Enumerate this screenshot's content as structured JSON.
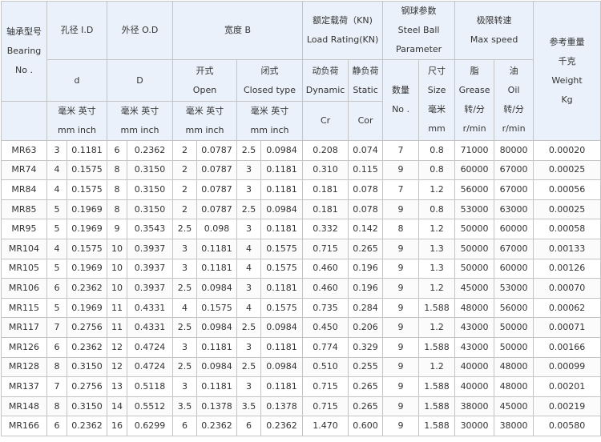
{
  "header": {
    "model": [
      "轴承型号",
      "Bearing",
      "No ."
    ],
    "id_title": "孔径 I.D",
    "od_title": "外径 O.D",
    "width_title": "宽度 B",
    "load_title": [
      "额定载荷（KN)",
      "Load Rating(KN)"
    ],
    "ball_title": [
      "钢球参数",
      "Steel Ball",
      "Parameter"
    ],
    "speed_title": [
      "极限转速",
      "Max speed"
    ],
    "weight_title": [
      "参考重量",
      "千克",
      "Weight",
      "Kg"
    ],
    "id_symbol": "d",
    "od_symbol": "D",
    "open": [
      "开式",
      "Open"
    ],
    "closed": [
      "闭式",
      "Closed type"
    ],
    "dynamic": [
      "动负荷",
      "Dynamic"
    ],
    "static": [
      "静负荷",
      "Static"
    ],
    "ball_num": [
      "数量",
      "No ."
    ],
    "ball_size": [
      "尺寸",
      "Size",
      "毫米",
      "mm"
    ],
    "grease": [
      "脂",
      "Grease",
      "转/分",
      "r/min"
    ],
    "oil": [
      "油",
      "Oil",
      "转/分",
      "r/min"
    ],
    "unit_id": [
      "毫米 英寸",
      "mm inch"
    ],
    "unit_od": [
      "毫米 英寸",
      "mm inch"
    ],
    "unit_open": [
      "毫米 英寸",
      "mm inch"
    ],
    "unit_closed": [
      "毫米 英寸",
      "mm inch"
    ],
    "cr": "Cr",
    "cor": "Cor"
  },
  "rows": [
    [
      "MR63",
      "3",
      "0.1181",
      "6",
      "0.2362",
      "2",
      "0.0787",
      "2.5",
      "0.0984",
      "0.208",
      "0.074",
      "7",
      "0.8",
      "71000",
      "80000",
      "0.00020"
    ],
    [
      "MR74",
      "4",
      "0.1575",
      "8",
      "0.3150",
      "2",
      "0.0787",
      "3",
      "0.1181",
      "0.310",
      "0.115",
      "9",
      "0.8",
      "60000",
      "67000",
      "0.00025"
    ],
    [
      "MR84",
      "4",
      "0.1575",
      "8",
      "0.3150",
      "2",
      "0.0787",
      "3",
      "0.1181",
      "0.181",
      "0.078",
      "7",
      "1.2",
      "56000",
      "67000",
      "0.00056"
    ],
    [
      "MR85",
      "5",
      "0.1969",
      "8",
      "0.3150",
      "2",
      "0.0787",
      "2.5",
      "0.0984",
      "0.181",
      "0.078",
      "9",
      "0.8",
      "53000",
      "63000",
      "0.00025"
    ],
    [
      "MR95",
      "5",
      "0.1969",
      "9",
      "0.3543",
      "2.5",
      "0.098",
      "3",
      "0.1181",
      "0.332",
      "0.142",
      "8",
      "1.2",
      "50000",
      "60000",
      "0.00058"
    ],
    [
      "MR104",
      "4",
      "0.1575",
      "10",
      "0.3937",
      "3",
      "0.1181",
      "4",
      "0.1575",
      "0.715",
      "0.265",
      "9",
      "1.3",
      "50000",
      "67000",
      "0.00133"
    ],
    [
      "MR105",
      "5",
      "0.1969",
      "10",
      "0.3937",
      "3",
      "0.1181",
      "4",
      "0.1575",
      "0.460",
      "0.196",
      "9",
      "1.3",
      "50000",
      "60000",
      "0.00126"
    ],
    [
      "MR106",
      "6",
      "0.2362",
      "10",
      "0.3937",
      "2.5",
      "0.0984",
      "3",
      "0.1181",
      "0.460",
      "0.196",
      "9",
      "1.2",
      "45000",
      "53000",
      "0.00070"
    ],
    [
      "MR115",
      "5",
      "0.1969",
      "11",
      "0.4331",
      "4",
      "0.1575",
      "4",
      "0.1575",
      "0.735",
      "0.284",
      "9",
      "1.588",
      "48000",
      "56000",
      "0.00062"
    ],
    [
      "MR117",
      "7",
      "0.2756",
      "11",
      "0.4331",
      "2.5",
      "0.0984",
      "2.5",
      "0.0984",
      "0.450",
      "0.206",
      "9",
      "1.2",
      "43000",
      "50000",
      "0.00071"
    ],
    [
      "MR126",
      "6",
      "0.2362",
      "12",
      "0.4724",
      "3",
      "0.1181",
      "3",
      "0.1181",
      "0.774",
      "0.329",
      "9",
      "1.588",
      "43000",
      "50000",
      "0.00166"
    ],
    [
      "MR128",
      "8",
      "0.3150",
      "12",
      "0.4724",
      "2.5",
      "0.0984",
      "2.5",
      "0.0984",
      "0.510",
      "0.255",
      "9",
      "1.2",
      "40000",
      "48000",
      "0.00099"
    ],
    [
      "MR137",
      "7",
      "0.2756",
      "13",
      "0.5118",
      "3",
      "0.1181",
      "3",
      "0.1181",
      "0.715",
      "0.265",
      "9",
      "1.588",
      "40000",
      "48000",
      "0.00201"
    ],
    [
      "MR148",
      "8",
      "0.3150",
      "14",
      "0.5512",
      "3.5",
      "0.1378",
      "3.5",
      "0.1378",
      "0.715",
      "0.265",
      "9",
      "1.588",
      "38000",
      "45000",
      "0.00219"
    ],
    [
      "MR166",
      "6",
      "0.2362",
      "16",
      "0.6299",
      "6",
      "0.2362",
      "6",
      "0.2362",
      "1.470",
      "0.600",
      "9",
      "1.588",
      "30000",
      "38000",
      "0.00580"
    ]
  ]
}
